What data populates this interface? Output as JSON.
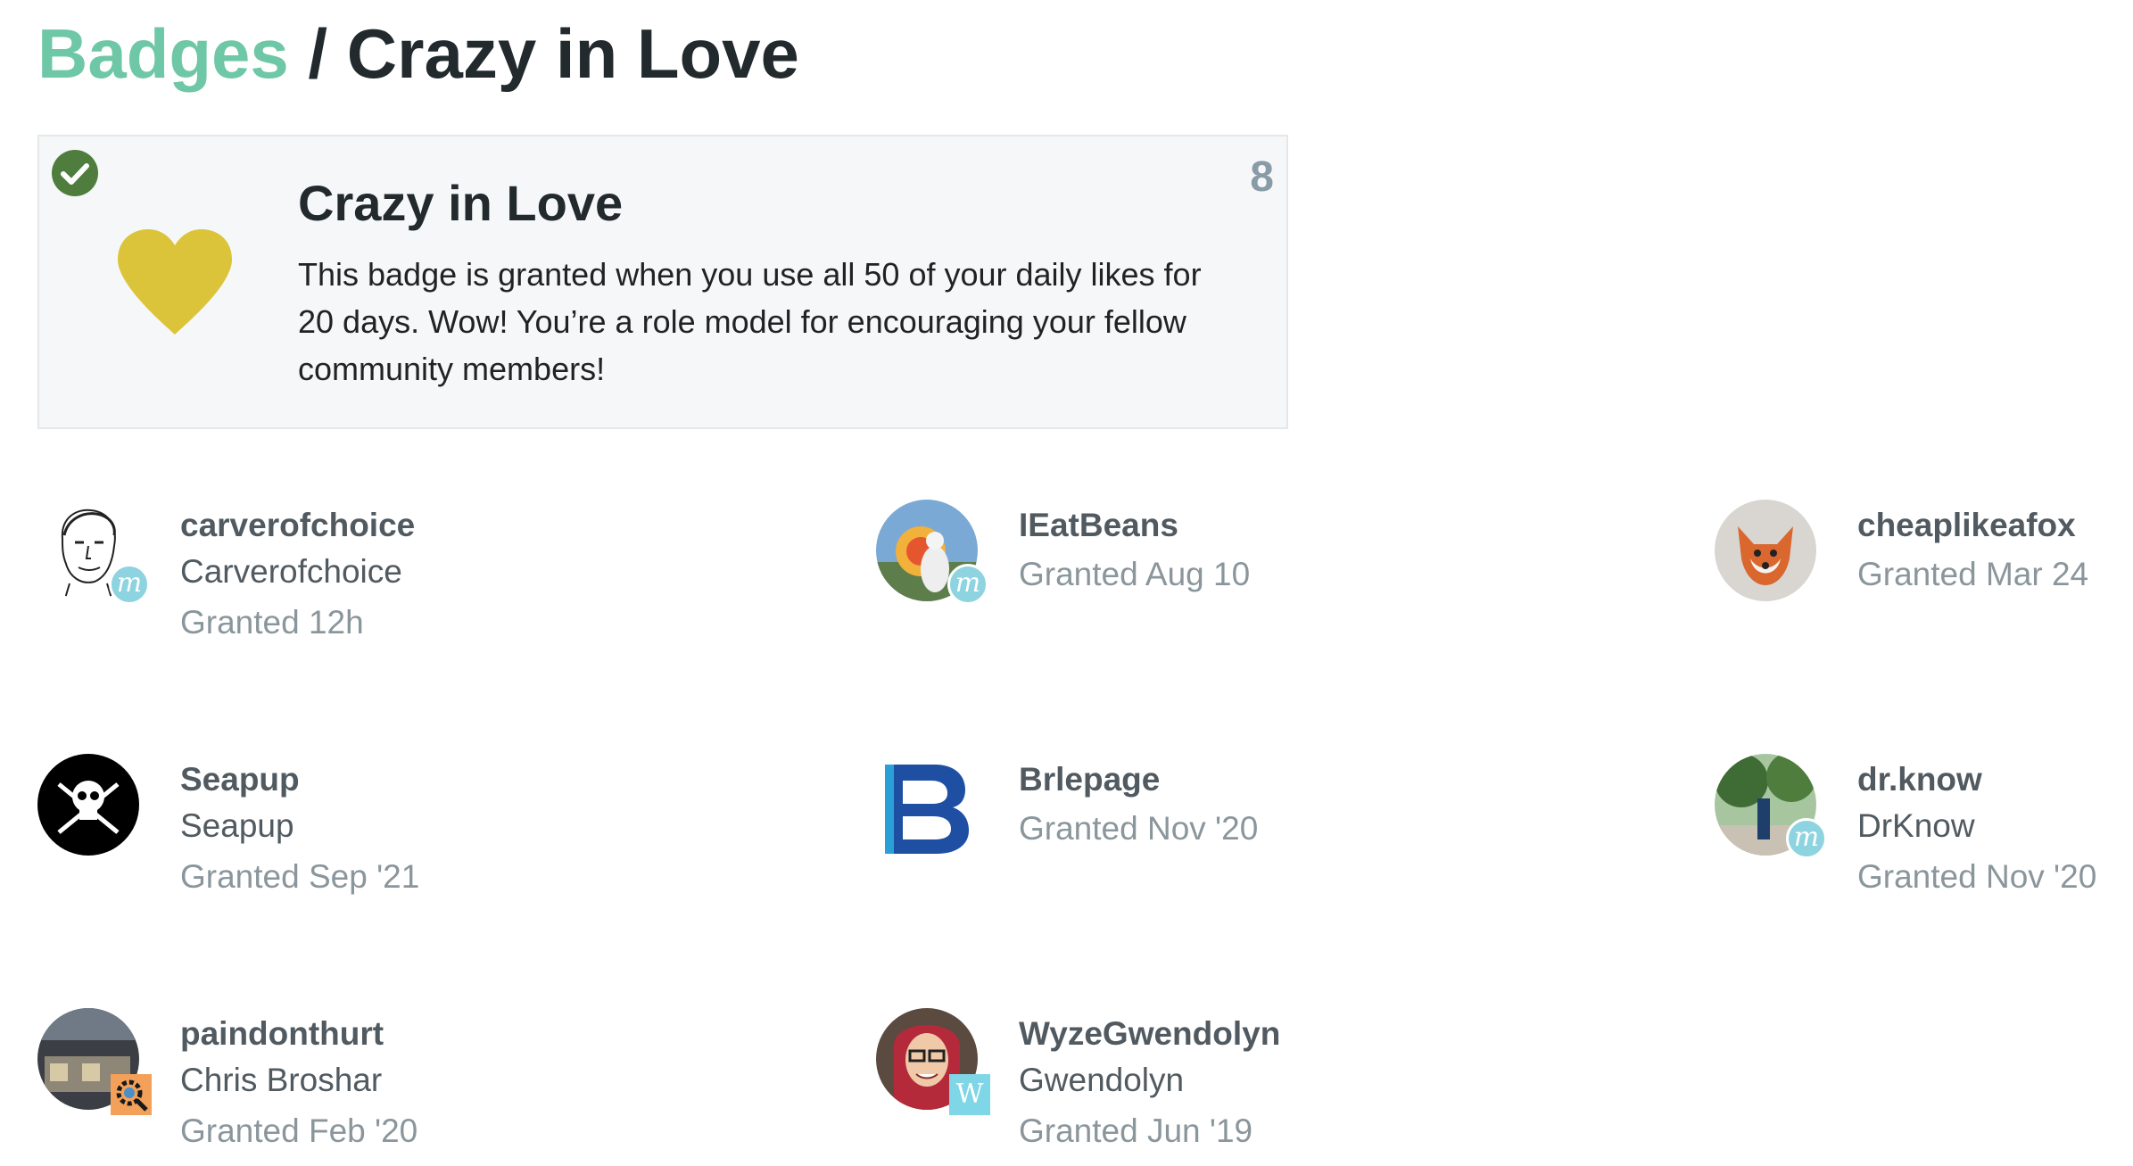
{
  "header": {
    "breadcrumb_label": "Badges",
    "separator": " / ",
    "title": "Crazy in Love"
  },
  "badge": {
    "icon": "heart-icon",
    "icon_color": "#dcc43a",
    "check_color": "#4e7d3d",
    "title": "Crazy in Love",
    "description": "This badge is granted when you use all 50 of your daily likes for 20 days. Wow! You’re a role model for encouraging your fellow community members!",
    "count": "8"
  },
  "colors": {
    "accent": "#6ec7a6",
    "muted": "#8a969c",
    "flair": "#8dd3e0"
  },
  "users": [
    {
      "username": "carverofchoice",
      "full_name": "Carverofchoice",
      "granted": "Granted 12h",
      "flair": "m"
    },
    {
      "username": "IEatBeans",
      "full_name": "",
      "granted": "Granted Aug 10",
      "flair": "m"
    },
    {
      "username": "cheaplikeafox",
      "full_name": "",
      "granted": "Granted Mar 24",
      "flair": ""
    },
    {
      "username": "Seapup",
      "full_name": "Seapup",
      "granted": "Granted Sep '21",
      "flair": ""
    },
    {
      "username": "Brlepage",
      "full_name": "",
      "granted": "Granted Nov '20",
      "flair": ""
    },
    {
      "username": "dr.know",
      "full_name": "DrKnow",
      "granted": "Granted Nov '20",
      "flair": "m"
    },
    {
      "username": "paindonthurt",
      "full_name": "Chris Broshar",
      "granted": "Granted Feb '20",
      "flair": "gear"
    },
    {
      "username": "WyzeGwendolyn",
      "full_name": "Gwendolyn",
      "granted": "Granted Jun '19",
      "flair": "W"
    }
  ]
}
